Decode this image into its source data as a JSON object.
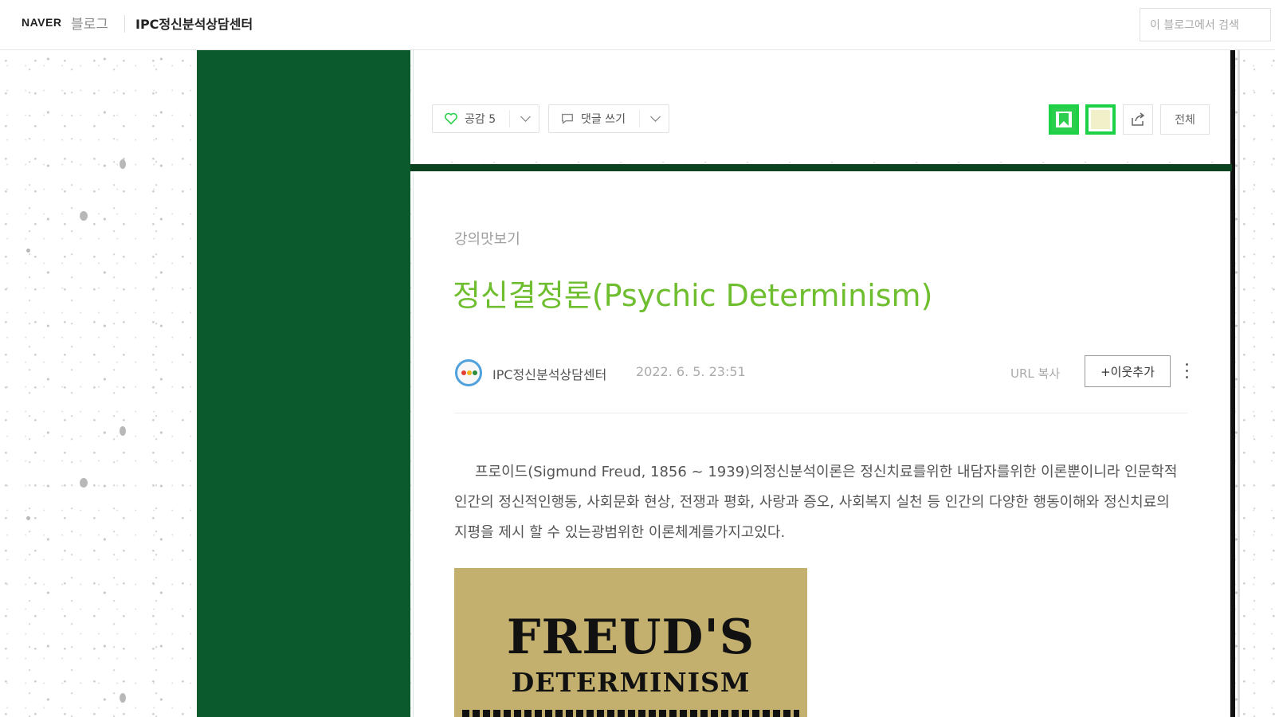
{
  "header": {
    "logo": "NAVER",
    "service": "블로그",
    "blog_name": "IPC정신분석상담센터",
    "search_placeholder": "이 블로그에서 검색"
  },
  "actions": {
    "like_label": "공감 5",
    "comment_label": "댓글 쓰기",
    "more_label": "전체"
  },
  "post": {
    "category": "강의맛보기",
    "title": "정신결정론(Psychic Determinism)",
    "author": "IPC정신분석상담센터",
    "date": "2022. 6. 5. 23:51",
    "url_copy": "URL 복사",
    "add_neighbor": "+이웃추가",
    "body": "프로이드(Sigmund Freud, 1856 ~ 1939)의정신분석이론은 정신치료를위한 내담자를위한 이론뿐이니라 인문학적 인간의 정신적인행동, 사회문화 현상, 전쟁과 평화, 사랑과 증오, 사회복지 실천 등 인간의 다양한 행동이해와 정신치료의 지평을 제시 할 수 있는광범위한 이론체계를가지고있다.",
    "image_title_1": "FREUD'S",
    "image_title_2": "DETERMINISM"
  },
  "colors": {
    "green_panel": "#0b5a2e",
    "title_green": "#6fbe2f",
    "naver_green": "#1dd147",
    "book_tan": "#c4b06e"
  },
  "icons": [
    "heart-icon",
    "chat-bubble-icon",
    "chevron-down-icon",
    "bookmark-icon",
    "memo-icon",
    "share-icon",
    "kebab-menu-icon"
  ]
}
